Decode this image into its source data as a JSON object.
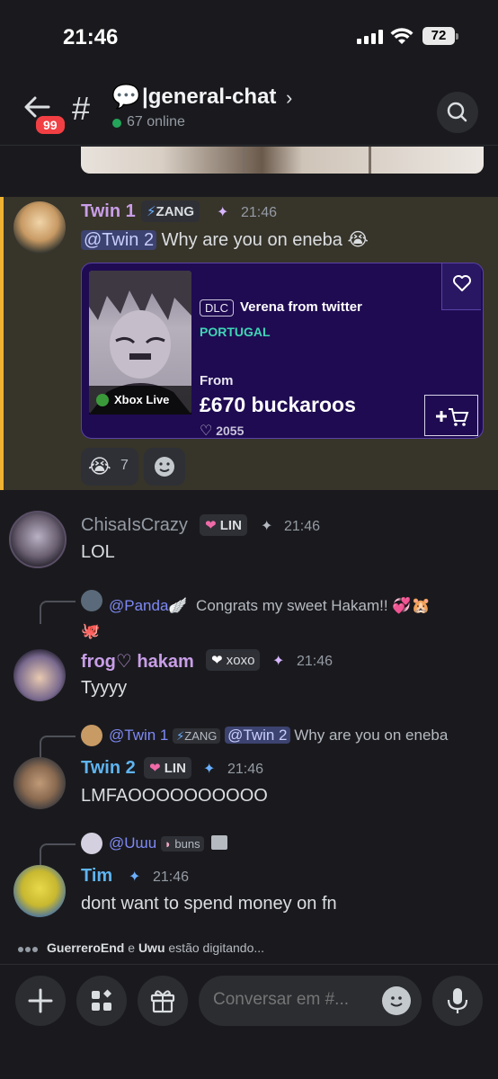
{
  "status_bar": {
    "time": "21:46",
    "battery": "72"
  },
  "header": {
    "unread_badge": "99",
    "channel_emoji": "💬",
    "channel_name": "|general-chat",
    "online": "67 online"
  },
  "messages": {
    "twin1": {
      "author": "Twin 1",
      "tag": "ZANG",
      "time": "21:46",
      "mention": "@Twin 2",
      "text": " Why are you on eneba 😭",
      "embed": {
        "platform": "Xbox Live",
        "dlc": "DLC",
        "title": "Verena from twitter",
        "region": "PORTUGAL",
        "from": "From",
        "price": "£670 buckaroos",
        "likes": "2055"
      },
      "reaction_emoji": "😭",
      "reaction_count": "7"
    },
    "chisa": {
      "author": "ChisaIsCrazy",
      "tag": "LIN",
      "time": "21:46",
      "text": "LOL"
    },
    "frog": {
      "reply_name": "@Panda🪽",
      "reply_text": "Congrats my sweet Hakam!! 💞🐹",
      "reply_extra": "🐙",
      "author": "frog♡ hakam",
      "tag": "xoxo",
      "time": "21:46",
      "text": "Tyyyy"
    },
    "twin2": {
      "reply_name": "@Twin 1",
      "reply_tag": "ZANG",
      "reply_mention": "@Twin 2",
      "reply_text": "Why are you on eneba",
      "author": "Twin 2",
      "tag": "LIN",
      "time": "21:46",
      "text": "LMFAOOOOOOOOOO"
    },
    "tim": {
      "reply_name": "@Uɯu",
      "reply_tag": "buns",
      "author": "Tim",
      "time": "21:46",
      "text": "dont want to spend money on fn"
    }
  },
  "typing": {
    "user1": "GuerreroEnd",
    "joiner": " e ",
    "user2": "Uwu",
    "suffix": " estão digitando..."
  },
  "composer": {
    "placeholder": "Conversar em #..."
  }
}
